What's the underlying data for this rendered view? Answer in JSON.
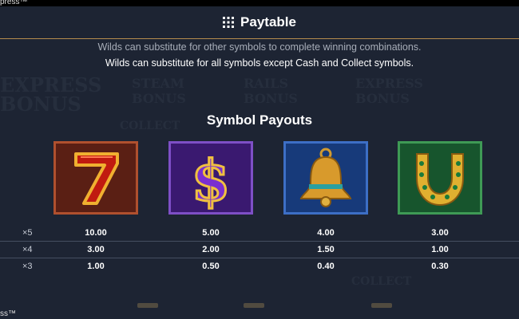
{
  "window": {
    "title_fragment": "press™",
    "bottom_fragment": "ss™"
  },
  "header": {
    "title": "Paytable"
  },
  "info": {
    "line1": "Wilds can substitute for other symbols to complete winning combinations.",
    "line2": "Wilds can substitute for all symbols except Cash and Collect symbols."
  },
  "section": {
    "title": "Symbol Payouts"
  },
  "symbols": [
    {
      "icon": "seven-icon",
      "color": "#5a1f14"
    },
    {
      "icon": "dollar-icon",
      "color": "#3a1970"
    },
    {
      "icon": "bell-icon",
      "color": "#173a7a"
    },
    {
      "icon": "horseshoe-icon",
      "color": "#17552d"
    }
  ],
  "payouts": [
    {
      "mult": "×5",
      "values": [
        "10.00",
        "5.00",
        "4.00",
        "3.00"
      ]
    },
    {
      "mult": "×4",
      "values": [
        "3.00",
        "2.00",
        "1.50",
        "1.00"
      ]
    },
    {
      "mult": "×3",
      "values": [
        "1.00",
        "0.50",
        "0.40",
        "0.30"
      ]
    }
  ],
  "colors": {
    "background": "#1d2433",
    "divider": "#b58b4c"
  }
}
